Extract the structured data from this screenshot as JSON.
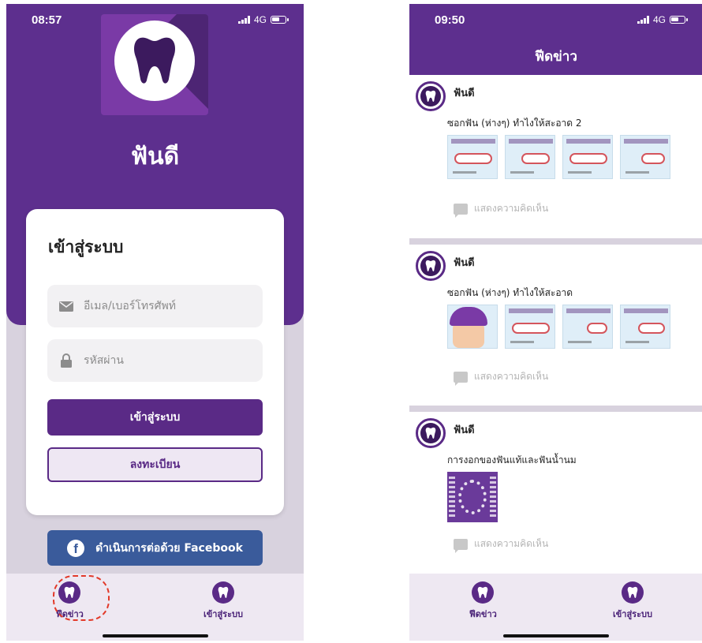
{
  "left_screen": {
    "status": {
      "time": "08:57",
      "network": "4G"
    },
    "app_name": "ฟันดี",
    "login": {
      "heading": "เข้าสู่ระบบ",
      "email_placeholder": "อีเมล/เบอร์โทรศัพท์",
      "password_placeholder": "รหัสผ่าน",
      "login_button": "เข้าสู่ระบบ",
      "register_button": "ลงทะเบียน"
    },
    "facebook_button": "ดำเนินการต่อด้วย Facebook",
    "tabs": [
      {
        "label": "ฟีดข่าว",
        "icon": "tooth-icon"
      },
      {
        "label": "เข้าสู่ระบบ",
        "icon": "tooth-icon"
      }
    ]
  },
  "right_screen": {
    "status": {
      "time": "09:50",
      "network": "4G"
    },
    "header_title": "ฟีดข่าว",
    "posts": [
      {
        "author": "ฟันดี",
        "title": "ซอกฟัน (ห่างๆ) ทำไงให้สะอาด 2",
        "comment_label": "แสดงความคิดเห็น"
      },
      {
        "author": "ฟันดี",
        "title": "ซอกฟัน (ห่างๆ) ทำไงให้สะอาด",
        "comment_label": "แสดงความคิดเห็น"
      },
      {
        "author": "ฟันดี",
        "title": "การงอกของฟันแท้และฟันน้ำนม",
        "comment_label": "แสดงความคิดเห็น"
      }
    ],
    "tabs": [
      {
        "label": "ฟีดข่าว",
        "icon": "tooth-icon"
      },
      {
        "label": "เข้าสู่ระบบ",
        "icon": "tooth-icon"
      }
    ]
  },
  "colors": {
    "brand_purple": "#5d2f8e",
    "facebook_blue": "#3a5b9b",
    "highlight_red": "#e23a2a"
  }
}
